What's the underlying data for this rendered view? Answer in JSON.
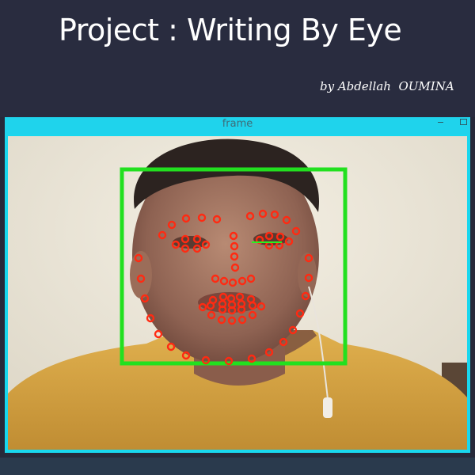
{
  "header": {
    "title": "Project : Writing By Eye",
    "byline": "by Abdellah  OUMINA"
  },
  "window": {
    "title": "frame"
  },
  "colors": {
    "header_bg": "#292c3f",
    "window_border": "#19d7ee",
    "face_box": "#22e01f",
    "landmark": "#ff2a12",
    "eye_line": "#2cf020"
  },
  "icons": [
    "minimize-icon",
    "maximize-icon"
  ]
}
